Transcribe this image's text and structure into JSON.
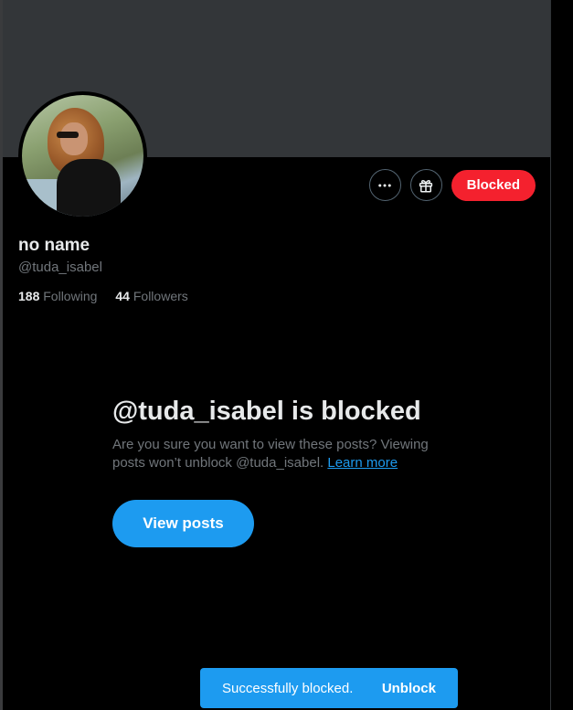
{
  "profile": {
    "display_name": "no name",
    "handle": "@tuda_isabel",
    "following_count": "188",
    "following_label": "Following",
    "followers_count": "44",
    "followers_label": "Followers"
  },
  "actions": {
    "more_icon": "more-horizontal-icon",
    "gift_icon": "gift-icon",
    "blocked_label": "Blocked"
  },
  "blocked_notice": {
    "title": "@tuda_isabel is blocked",
    "description": "Are you sure you want to view these posts? Viewing posts won’t unblock @tuda_isabel.",
    "learn_more": "Learn more",
    "view_posts_label": "View posts"
  },
  "toast": {
    "message": "Successfully blocked.",
    "undo_label": "Unblock"
  },
  "colors": {
    "background": "#000000",
    "banner": "#333639",
    "accent": "#1d9bf0",
    "blocked": "#f4212e",
    "text_primary": "#e7e9ea",
    "text_secondary": "#71767b"
  }
}
